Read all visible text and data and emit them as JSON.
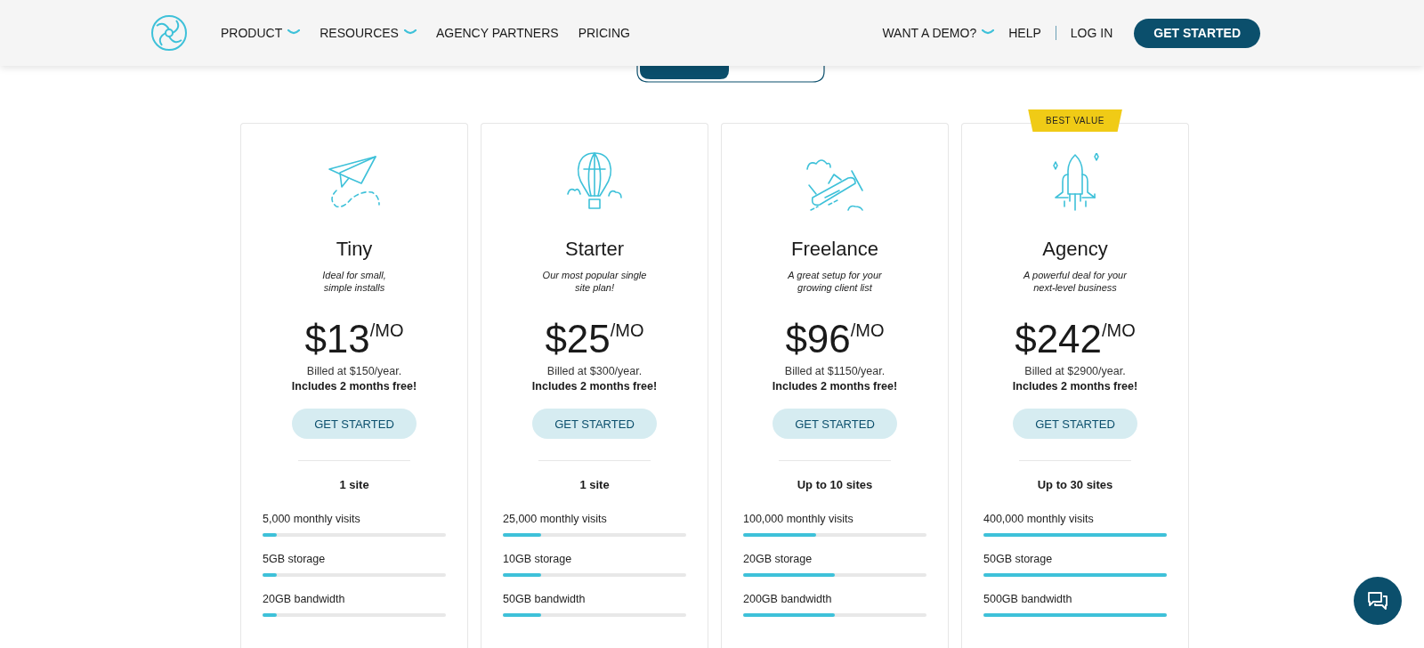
{
  "header": {
    "nav": [
      {
        "label": "PRODUCT",
        "dropdown": true
      },
      {
        "label": "RESOURCES",
        "dropdown": true
      },
      {
        "label": "AGENCY PARTNERS",
        "dropdown": false
      },
      {
        "label": "PRICING",
        "dropdown": false
      }
    ],
    "right_nav": [
      {
        "label": "WANT A DEMO?",
        "dropdown": true
      },
      {
        "label": "HELP",
        "dropdown": false
      },
      {
        "label": "LOG IN",
        "dropdown": false
      }
    ],
    "cta": "GET STARTED"
  },
  "billing_toggle": {
    "options": [
      {
        "selected": true
      },
      {
        "selected": false
      }
    ]
  },
  "plans": [
    {
      "kind": "plane",
      "name": "Tiny",
      "tagline": [
        "Ideal for small,",
        "simple installs"
      ],
      "price": "$13",
      "unit": "/MO",
      "billed": "Billed at $150/year.",
      "bonus": "Includes 2 months free!",
      "button": "GET STARTED",
      "sites": "1 site",
      "features": [
        {
          "label": "5,000 monthly visits",
          "level": 0.08
        },
        {
          "label": "5GB storage",
          "level": 0.08
        },
        {
          "label": "20GB bandwidth",
          "level": 0.08
        }
      ]
    },
    {
      "kind": "balloon",
      "name": "Starter",
      "tagline": [
        "Our most popular single",
        "site plan!"
      ],
      "price": "$25",
      "unit": "/MO",
      "billed": "Billed at $300/year.",
      "bonus": "Includes 2 months free!",
      "button": "GET STARTED",
      "sites": "1 site",
      "features": [
        {
          "label": "25,000 monthly visits",
          "level": 0.21
        },
        {
          "label": "10GB storage",
          "level": 0.21
        },
        {
          "label": "50GB bandwidth",
          "level": 0.21
        }
      ]
    },
    {
      "kind": "airplane",
      "name": "Freelance",
      "tagline": [
        "A great setup for your",
        "growing client list"
      ],
      "price": "$96",
      "unit": "/MO",
      "billed": "Billed at $1150/year.",
      "bonus": "Includes 2 months free!",
      "button": "GET STARTED",
      "sites": "Up to 10 sites",
      "features": [
        {
          "label": "100,000 monthly visits",
          "level": 0.4
        },
        {
          "label": "20GB storage",
          "level": 0.5
        },
        {
          "label": "200GB bandwidth",
          "level": 0.5
        }
      ]
    },
    {
      "kind": "rocket",
      "badge": "BEST VALUE",
      "name": "Agency",
      "tagline": [
        "A powerful deal for your",
        "next-level business"
      ],
      "price": "$242",
      "unit": "/MO",
      "billed": "Billed at $2900/year.",
      "bonus": "Includes 2 months free!",
      "button": "GET STARTED",
      "sites": "Up to 30 sites",
      "features": [
        {
          "label": "400,000 monthly visits",
          "level": 1
        },
        {
          "label": "50GB storage",
          "level": 1
        },
        {
          "label": "500GB bandwidth",
          "level": 1
        }
      ]
    }
  ]
}
